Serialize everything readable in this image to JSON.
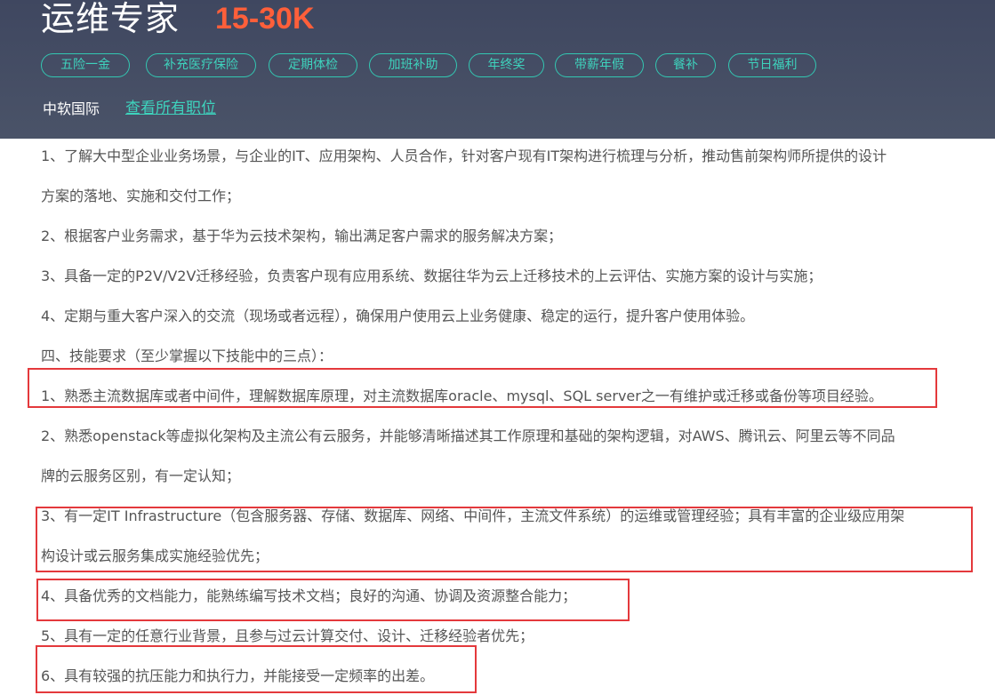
{
  "header": {
    "title": "运维专家",
    "salary": "15-30K",
    "tags": [
      "五险一金",
      "补充医疗保险",
      "定期体检",
      "加班补助",
      "年终奖",
      "带薪年假",
      "餐补",
      "节日福利"
    ],
    "company": "中软国际",
    "all_jobs_link": "查看所有职位"
  },
  "description": {
    "lines": [
      "1、了解大中型企业业务场景，与企业的IT、应用架构、人员合作，针对客户现有IT架构进行梳理与分析，推动售前架构师所提供的设计",
      "方案的落地、实施和交付工作；",
      "2、根据客户业务需求，基于华为云技术架构，输出满足客户需求的服务解决方案；",
      "3、具备一定的P2V/V2V迁移经验，负责客户现有应用系统、数据往华为云上迁移技术的上云评估、实施方案的设计与实施；",
      "4、定期与重大客户深入的交流（现场或者远程），确保用户使用云上业务健康、稳定的运行，提升客户使用体验。",
      "四、技能要求（至少掌握以下技能中的三点）：",
      "1、熟悉主流数据库或者中间件，理解数据库原理，对主流数据库oracle、mysql、SQL server之一有维护或迁移或备份等项目经验。",
      "2、熟悉openstack等虚拟化架构及主流公有云服务，并能够清晰描述其工作原理和基础的架构逻辑，对AWS、腾讯云、阿里云等不同品",
      "牌的云服务区别，有一定认知；",
      "3、有一定IT Infrastructure（包含服务器、存储、数据库、网络、中间件，主流文件系统）的运维或管理经验；具有丰富的企业级应用架",
      "构设计或云服务集成实施经验优先；",
      "4、具备优秀的文档能力，能熟练编写技术文档；良好的沟通、协调及资源整合能力；",
      "5、具有一定的任意行业背景，且参与过云计算交付、设计、迁移经验者优先；",
      "6、具有较强的抗压能力和执行力，并能接受一定频率的出差。"
    ]
  },
  "annotations": {
    "highlight_color": "#e4393c"
  }
}
